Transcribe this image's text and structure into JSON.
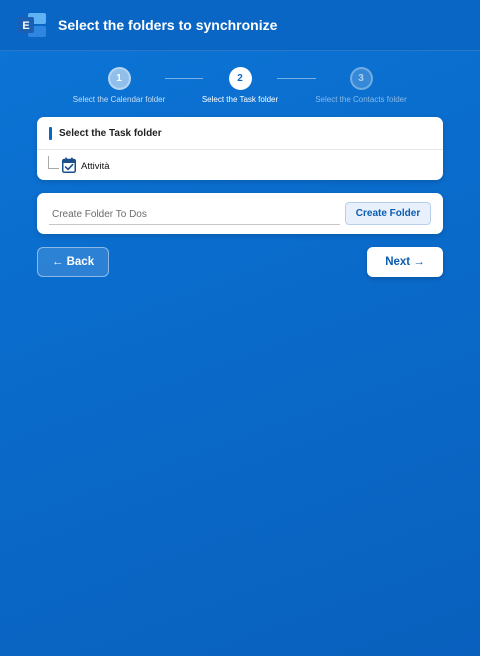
{
  "header": {
    "title": "Select the folders to synchronize",
    "logo_icon": "exchange-logo-icon"
  },
  "stepper": {
    "steps": [
      {
        "number": "1",
        "label": "Select the Calendar folder",
        "state": "done"
      },
      {
        "number": "2",
        "label": "Select the Task folder",
        "state": "active"
      },
      {
        "number": "3",
        "label": "Select the Contacts folder",
        "state": "todo"
      }
    ]
  },
  "folder_panel": {
    "header": "Select the Task folder",
    "items": [
      {
        "label": "Attività",
        "icon": "task-calendar-icon"
      }
    ]
  },
  "create_folder": {
    "placeholder": "Create Folder To Dos",
    "button_label": "Create Folder"
  },
  "nav": {
    "back_label": "← Back",
    "next_label": "Next →"
  },
  "colors": {
    "background": "#0a6ccc",
    "accent": "#0a66c4",
    "card": "#ffffff"
  }
}
